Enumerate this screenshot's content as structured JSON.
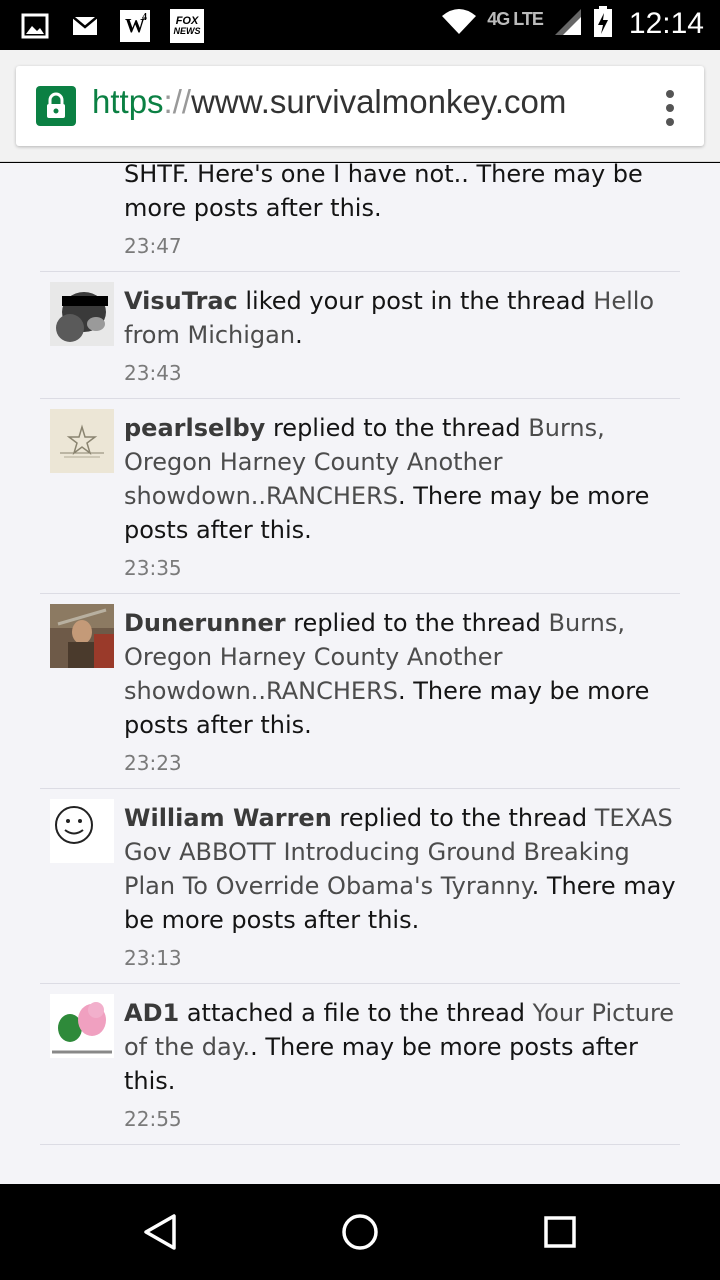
{
  "status_bar": {
    "icons_left": [
      "image-icon",
      "mail-icon",
      "w4-icon",
      "fox-news-icon"
    ],
    "w_label": "W",
    "w_sup": "4",
    "fox_line1": "FOX",
    "fox_line2": "NEWS",
    "network": "4G LTE",
    "time": "12:14"
  },
  "browser": {
    "url_scheme": "https",
    "url_separator": "://",
    "url_host": "www.survivalmonkey.com",
    "lock_color": "#0b8043"
  },
  "feed": {
    "items": [
      {
        "user": "",
        "prefix": "lot of \"prepper\" topics, regarding when the SHTF. Here's one I have not",
        "action": "",
        "thread": "",
        "suffix": ".. There may be more posts after this.",
        "time": "23:47"
      },
      {
        "user": "VisuTrac",
        "action": " liked your post in the thread ",
        "thread": "Hello from Michigan",
        "suffix": ".",
        "time": "23:43"
      },
      {
        "user": "pearlselby",
        "action": " replied to the thread ",
        "thread": "Burns, Oregon Harney County Another showdown..RANCHERS",
        "suffix": ". There may be more posts after this.",
        "time": "23:35"
      },
      {
        "user": "Dunerunner",
        "action": " replied to the thread ",
        "thread": "Burns, Oregon Harney County Another showdown..RANCHERS",
        "suffix": ". There may be more posts after this.",
        "time": "23:23"
      },
      {
        "user": "William Warren",
        "action": " replied to the thread ",
        "thread": "TEXAS Gov ABBOTT Introducing Ground Breaking Plan To Override Obama's Tyranny",
        "suffix": ". There may be more posts after this.",
        "time": "23:13"
      },
      {
        "user": "AD1",
        "action": " attached a file to the thread ",
        "thread": "Your Picture of the day.",
        "suffix": ". There may be more posts after this.",
        "time": "22:55"
      }
    ]
  },
  "nav": {
    "buttons": [
      "back-triangle",
      "home-circle",
      "recents-square"
    ]
  }
}
